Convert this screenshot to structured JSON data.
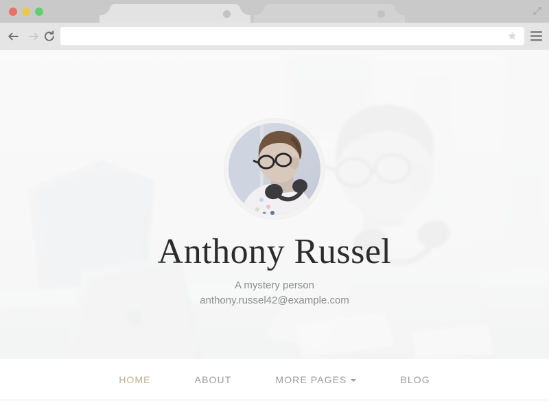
{
  "browser": {
    "traffic_lights": [
      {
        "name": "close",
        "color": "#ec6f68"
      },
      {
        "name": "minimize",
        "color": "#eac84f"
      },
      {
        "name": "maximize",
        "color": "#63ce70"
      }
    ],
    "tabs": [
      {
        "title": "",
        "active": true
      },
      {
        "title": "",
        "active": false
      }
    ],
    "toolbar": {
      "back_icon": "arrow-left-icon",
      "forward_icon": "arrow-right-icon",
      "reload_icon": "reload-icon",
      "bookmark_icon": "star-icon",
      "menu_icon": "hamburger-menu-icon",
      "expand_icon": "expand-arrows-icon",
      "url_value": "",
      "url_placeholder": ""
    }
  },
  "hero": {
    "avatar_alt": "profile-photo",
    "name": "Anthony Russel",
    "tagline": "A mystery person",
    "email": "anthony.russel42@example.com"
  },
  "site_nav": {
    "items": [
      {
        "label": "HOME",
        "active": true,
        "has_caret": false
      },
      {
        "label": "ABOUT",
        "active": false,
        "has_caret": false
      },
      {
        "label": "MORE PAGES",
        "active": false,
        "has_caret": true
      },
      {
        "label": "BLOG",
        "active": false,
        "has_caret": false
      }
    ]
  },
  "colors": {
    "accent": "#bfae8e",
    "nav_text": "#9a9a9a",
    "heading": "#2c2c2c",
    "subtext": "#8c8c8c",
    "chrome": "#c9c9c9",
    "toolbar": "#e5e5e5"
  }
}
